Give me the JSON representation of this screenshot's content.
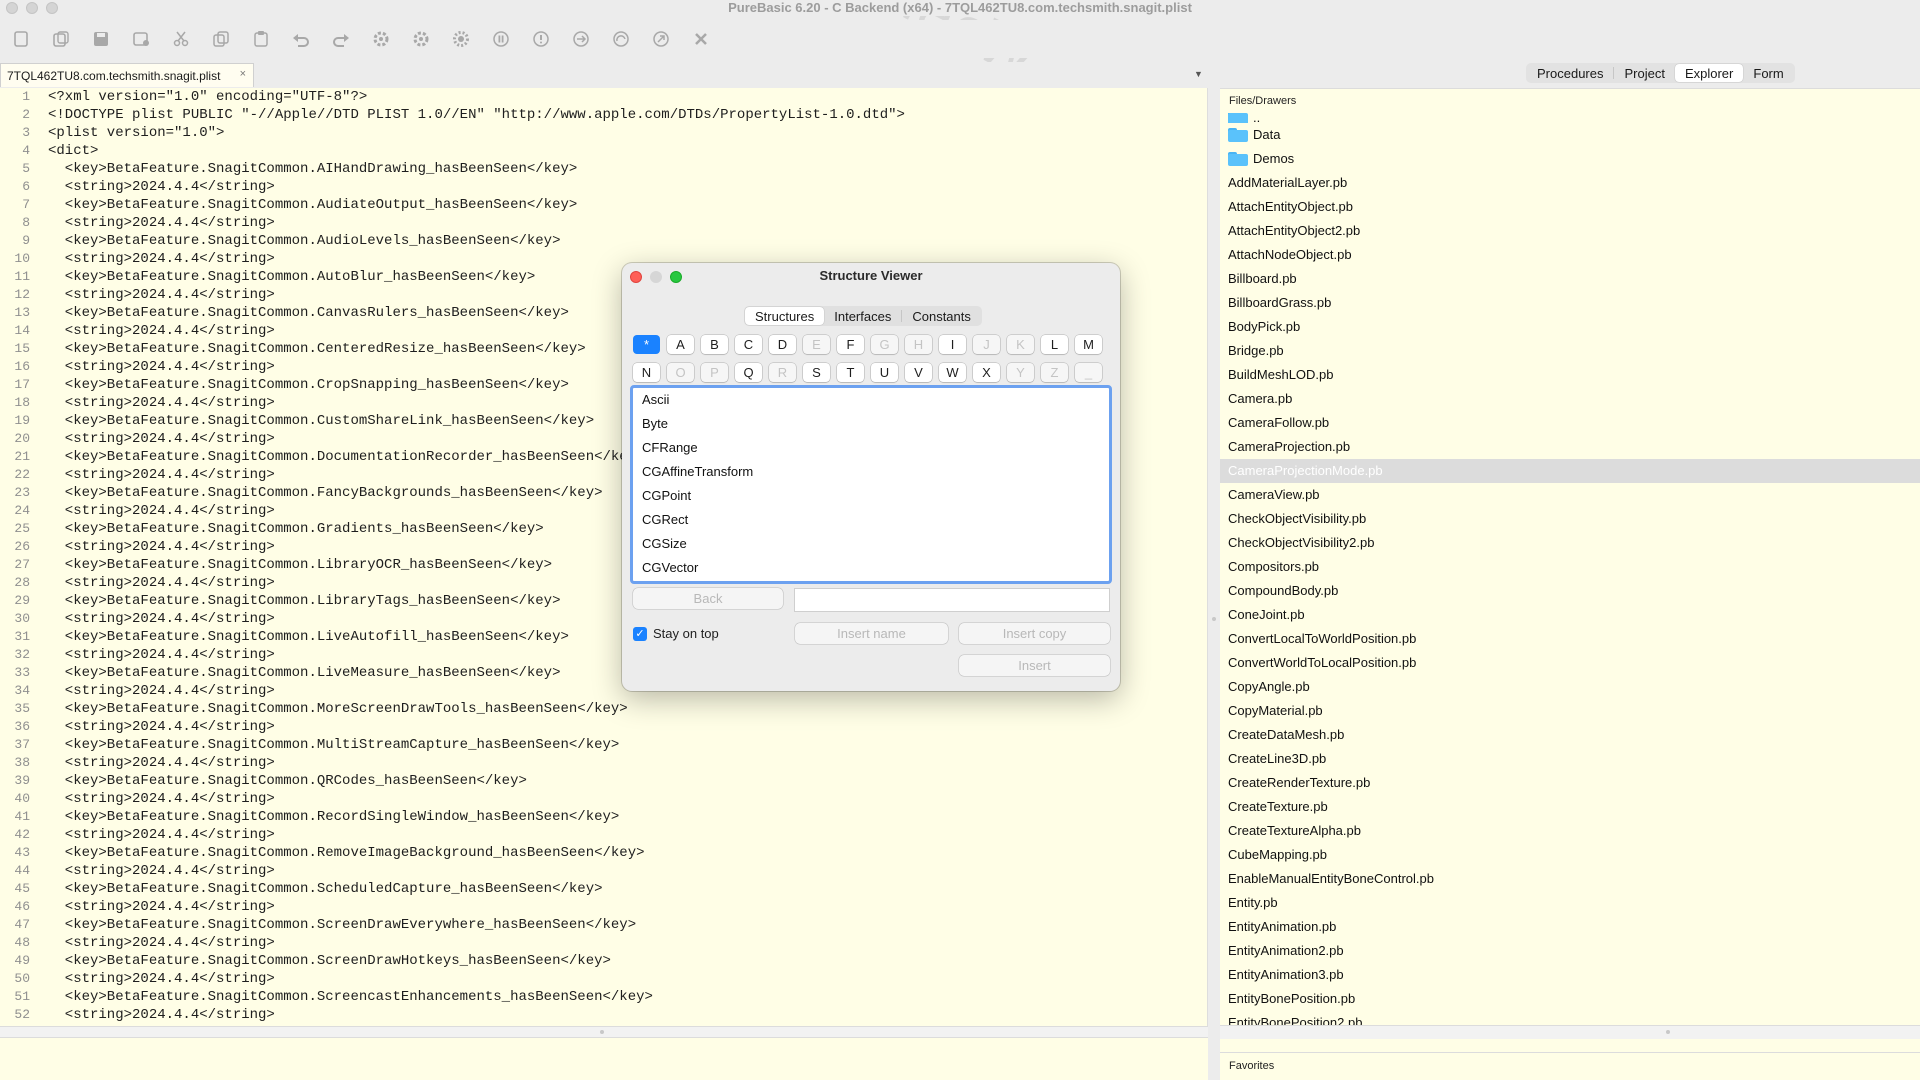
{
  "window": {
    "title": "PureBasic 6.20 - C Backend (x64) - 7TQL462TU8.com.techsmith.snagit.plist"
  },
  "toolbar": {
    "buttons": [
      "new-file-icon",
      "open-file-icon",
      "save-icon",
      "save-as-icon",
      "cut-icon",
      "copy-icon",
      "paste-icon",
      "undo-icon",
      "redo-icon",
      "compile-run-icon",
      "debugger-icon",
      "settings-icon",
      "pause-icon",
      "stop-icon",
      "step-icon",
      "step-over-icon",
      "step-out-icon",
      "kill-icon"
    ]
  },
  "editor": {
    "tab_label": "7TQL462TU8.com.techsmith.snagit.plist",
    "tab_close": "×",
    "lines": [
      "<?xml version=\"1.0\" encoding=\"UTF-8\"?>",
      "<!DOCTYPE plist PUBLIC \"-//Apple//DTD PLIST 1.0//EN\" \"http://www.apple.com/DTDs/PropertyList-1.0.dtd\">",
      "<plist version=\"1.0\">",
      "<dict>",
      "  <key>BetaFeature.SnagitCommon.AIHandDrawing_hasBeenSeen</key>",
      "  <string>2024.4.4</string>",
      "  <key>BetaFeature.SnagitCommon.AudiateOutput_hasBeenSeen</key>",
      "  <string>2024.4.4</string>",
      "  <key>BetaFeature.SnagitCommon.AudioLevels_hasBeenSeen</key>",
      "  <string>2024.4.4</string>",
      "  <key>BetaFeature.SnagitCommon.AutoBlur_hasBeenSeen</key>",
      "  <string>2024.4.4</string>",
      "  <key>BetaFeature.SnagitCommon.CanvasRulers_hasBeenSeen</key>",
      "  <string>2024.4.4</string>",
      "  <key>BetaFeature.SnagitCommon.CenteredResize_hasBeenSeen</key>",
      "  <string>2024.4.4</string>",
      "  <key>BetaFeature.SnagitCommon.CropSnapping_hasBeenSeen</key>",
      "  <string>2024.4.4</string>",
      "  <key>BetaFeature.SnagitCommon.CustomShareLink_hasBeenSeen</key>",
      "  <string>2024.4.4</string>",
      "  <key>BetaFeature.SnagitCommon.DocumentationRecorder_hasBeenSeen</key>",
      "  <string>2024.4.4</string>",
      "  <key>BetaFeature.SnagitCommon.FancyBackgrounds_hasBeenSeen</key>",
      "  <string>2024.4.4</string>",
      "  <key>BetaFeature.SnagitCommon.Gradients_hasBeenSeen</key>",
      "  <string>2024.4.4</string>",
      "  <key>BetaFeature.SnagitCommon.LibraryOCR_hasBeenSeen</key>",
      "  <string>2024.4.4</string>",
      "  <key>BetaFeature.SnagitCommon.LibraryTags_hasBeenSeen</key>",
      "  <string>2024.4.4</string>",
      "  <key>BetaFeature.SnagitCommon.LiveAutofill_hasBeenSeen</key>",
      "  <string>2024.4.4</string>",
      "  <key>BetaFeature.SnagitCommon.LiveMeasure_hasBeenSeen</key>",
      "  <string>2024.4.4</string>",
      "  <key>BetaFeature.SnagitCommon.MoreScreenDrawTools_hasBeenSeen</key>",
      "  <string>2024.4.4</string>",
      "  <key>BetaFeature.SnagitCommon.MultiStreamCapture_hasBeenSeen</key>",
      "  <string>2024.4.4</string>",
      "  <key>BetaFeature.SnagitCommon.QRCodes_hasBeenSeen</key>",
      "  <string>2024.4.4</string>",
      "  <key>BetaFeature.SnagitCommon.RecordSingleWindow_hasBeenSeen</key>",
      "  <string>2024.4.4</string>",
      "  <key>BetaFeature.SnagitCommon.RemoveImageBackground_hasBeenSeen</key>",
      "  <string>2024.4.4</string>",
      "  <key>BetaFeature.SnagitCommon.ScheduledCapture_hasBeenSeen</key>",
      "  <string>2024.4.4</string>",
      "  <key>BetaFeature.SnagitCommon.ScreenDrawEverywhere_hasBeenSeen</key>",
      "  <string>2024.4.4</string>",
      "  <key>BetaFeature.SnagitCommon.ScreenDrawHotkeys_hasBeenSeen</key>",
      "  <string>2024.4.4</string>",
      "  <key>BetaFeature.SnagitCommon.ScreencastEnhancements_hasBeenSeen</key>",
      "  <string>2024.4.4</string>"
    ]
  },
  "right_panel": {
    "tabs": [
      {
        "label": "Procedures",
        "active": false
      },
      {
        "label": "Project",
        "active": false
      },
      {
        "label": "Explorer",
        "active": true
      },
      {
        "label": "Form",
        "active": false
      }
    ],
    "files_label": "Files/Drawers",
    "favorites_label": "Favorites",
    "selected_file": "CameraProjectionMode.pb",
    "files": [
      {
        "name": "..",
        "type": "folder",
        "partial": true
      },
      {
        "name": "Data",
        "type": "folder"
      },
      {
        "name": "Demos",
        "type": "folder"
      },
      {
        "name": "AddMaterialLayer.pb",
        "type": "file"
      },
      {
        "name": "AttachEntityObject.pb",
        "type": "file"
      },
      {
        "name": "AttachEntityObject2.pb",
        "type": "file"
      },
      {
        "name": "AttachNodeObject.pb",
        "type": "file"
      },
      {
        "name": "Billboard.pb",
        "type": "file"
      },
      {
        "name": "BillboardGrass.pb",
        "type": "file"
      },
      {
        "name": "BodyPick.pb",
        "type": "file"
      },
      {
        "name": "Bridge.pb",
        "type": "file"
      },
      {
        "name": "BuildMeshLOD.pb",
        "type": "file"
      },
      {
        "name": "Camera.pb",
        "type": "file"
      },
      {
        "name": "CameraFollow.pb",
        "type": "file"
      },
      {
        "name": "CameraProjection.pb",
        "type": "file"
      },
      {
        "name": "CameraProjectionMode.pb",
        "type": "file"
      },
      {
        "name": "CameraView.pb",
        "type": "file"
      },
      {
        "name": "CheckObjectVisibility.pb",
        "type": "file"
      },
      {
        "name": "CheckObjectVisibility2.pb",
        "type": "file"
      },
      {
        "name": "Compositors.pb",
        "type": "file"
      },
      {
        "name": "CompoundBody.pb",
        "type": "file"
      },
      {
        "name": "ConeJoint.pb",
        "type": "file"
      },
      {
        "name": "ConvertLocalToWorldPosition.pb",
        "type": "file"
      },
      {
        "name": "ConvertWorldToLocalPosition.pb",
        "type": "file"
      },
      {
        "name": "CopyAngle.pb",
        "type": "file"
      },
      {
        "name": "CopyMaterial.pb",
        "type": "file"
      },
      {
        "name": "CreateDataMesh.pb",
        "type": "file"
      },
      {
        "name": "CreateLine3D.pb",
        "type": "file"
      },
      {
        "name": "CreateRenderTexture.pb",
        "type": "file"
      },
      {
        "name": "CreateTexture.pb",
        "type": "file"
      },
      {
        "name": "CreateTextureAlpha.pb",
        "type": "file"
      },
      {
        "name": "CubeMapping.pb",
        "type": "file"
      },
      {
        "name": "EnableManualEntityBoneControl.pb",
        "type": "file"
      },
      {
        "name": "Entity.pb",
        "type": "file"
      },
      {
        "name": "EntityAnimation.pb",
        "type": "file"
      },
      {
        "name": "EntityAnimation2.pb",
        "type": "file"
      },
      {
        "name": "EntityAnimation3.pb",
        "type": "file"
      },
      {
        "name": "EntityBonePosition.pb",
        "type": "file"
      },
      {
        "name": "EntityBonePosition2.pb",
        "type": "file"
      }
    ]
  },
  "dialog": {
    "title": "Structure Viewer",
    "tabs": [
      {
        "label": "Structures",
        "active": true
      },
      {
        "label": "Interfaces",
        "active": false
      },
      {
        "label": "Constants",
        "active": false
      }
    ],
    "letters_row1": [
      {
        "label": "*",
        "state": "active"
      },
      {
        "label": "A",
        "state": "enabled"
      },
      {
        "label": "B",
        "state": "enabled"
      },
      {
        "label": "C",
        "state": "enabled"
      },
      {
        "label": "D",
        "state": "enabled"
      },
      {
        "label": "E",
        "state": "disabled"
      },
      {
        "label": "F",
        "state": "enabled"
      },
      {
        "label": "G",
        "state": "disabled"
      },
      {
        "label": "H",
        "state": "disabled"
      },
      {
        "label": "I",
        "state": "enabled"
      },
      {
        "label": "J",
        "state": "disabled"
      },
      {
        "label": "K",
        "state": "disabled"
      },
      {
        "label": "L",
        "state": "enabled"
      },
      {
        "label": "M",
        "state": "enabled"
      }
    ],
    "letters_row2": [
      {
        "label": "N",
        "state": "enabled"
      },
      {
        "label": "O",
        "state": "disabled"
      },
      {
        "label": "P",
        "state": "disabled"
      },
      {
        "label": "Q",
        "state": "enabled"
      },
      {
        "label": "R",
        "state": "disabled"
      },
      {
        "label": "S",
        "state": "enabled"
      },
      {
        "label": "T",
        "state": "enabled"
      },
      {
        "label": "U",
        "state": "enabled"
      },
      {
        "label": "V",
        "state": "enabled"
      },
      {
        "label": "W",
        "state": "enabled"
      },
      {
        "label": "X",
        "state": "enabled"
      },
      {
        "label": "Y",
        "state": "disabled"
      },
      {
        "label": "Z",
        "state": "disabled"
      },
      {
        "label": "_",
        "state": "disabled"
      }
    ],
    "structures": [
      "Ascii",
      "Byte",
      "CFRange",
      "CGAffineTransform",
      "CGPoint",
      "CGRect",
      "CGSize",
      "CGVector"
    ],
    "back_label": "Back",
    "path_value": "",
    "stay_on_top_label": "Stay on top",
    "stay_on_top_checked": true,
    "insert_name_label": "Insert name",
    "insert_copy_label": "Insert copy",
    "insert_label": "Insert"
  },
  "watermark": "MacW.com",
  "colors": {
    "editor_bg": "#fffee6",
    "accent": "#1a82ff",
    "close_red": "#fe5f57",
    "minimize_yellow": "#febc2e",
    "zoom_green": "#28c840"
  }
}
